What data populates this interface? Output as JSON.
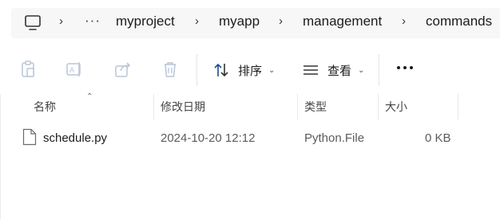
{
  "address_bar": {
    "overflow": "···",
    "crumbs": [
      "myproject",
      "myapp",
      "management",
      "commands"
    ]
  },
  "toolbar": {
    "sort_label": "排序",
    "view_label": "查看",
    "more_label": "···"
  },
  "columns": {
    "name": "名称",
    "modified": "修改日期",
    "type": "类型",
    "size": "大小"
  },
  "files": [
    {
      "name": "schedule.py",
      "modified": "2024-10-20 12:12",
      "type": "Python.File",
      "size": "0 KB"
    }
  ]
}
